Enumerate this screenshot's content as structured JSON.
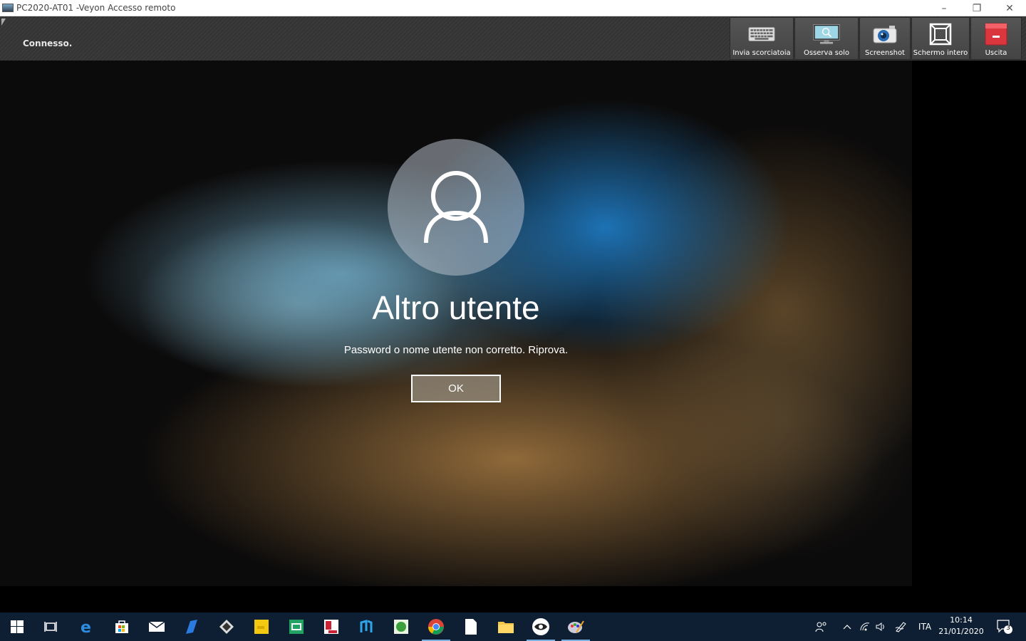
{
  "window": {
    "title": "PC2020-AT01 -Veyon Accesso remoto",
    "controls": {
      "minimize": "–",
      "maximize": "❐",
      "close": "✕"
    }
  },
  "toolbar": {
    "status": "Connesso.",
    "buttons": [
      {
        "label": "Invia scorciatoia",
        "icon": "keyboard-icon"
      },
      {
        "label": "Osserva solo",
        "icon": "monitor-view-icon"
      },
      {
        "label": "Screenshot",
        "icon": "camera-icon"
      },
      {
        "label": "Schermo intero",
        "icon": "fullscreen-icon"
      },
      {
        "label": "Uscita",
        "icon": "exit-icon"
      }
    ]
  },
  "lock_screen": {
    "username": "Altro utente",
    "message": "Password o nome utente non corretto. Riprova.",
    "ok_label": "OK"
  },
  "taskbar": {
    "apps": [
      "start-icon",
      "task-view-icon",
      "edge-icon",
      "store-icon",
      "mail-icon",
      "pen-app-icon",
      "app-diamond-icon",
      "sticky-notes-icon",
      "app-green-icon",
      "media-app-icon",
      "app-n-icon",
      "app-leaf-icon",
      "chrome-icon",
      "file-icon",
      "folder-icon",
      "veyon-eye-icon",
      "paint-icon"
    ],
    "tray": {
      "language": "ITA",
      "time": "10:14",
      "date": "21/01/2020",
      "notifications": "3"
    }
  },
  "colors": {
    "toolbar_bg": "#333333",
    "taskbar_bg": "#0f1f33",
    "exit_red": "#d9363e",
    "accent": "#7ab0e0"
  }
}
